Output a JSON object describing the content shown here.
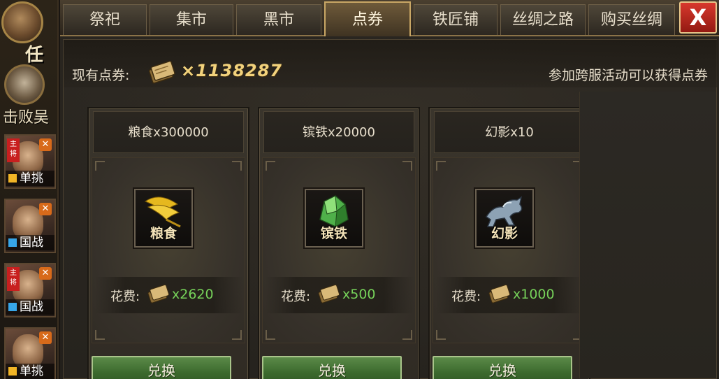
{
  "tabs": [
    {
      "label": "祭祀",
      "active": false
    },
    {
      "label": "集市",
      "active": false
    },
    {
      "label": "黑市",
      "active": false
    },
    {
      "label": "点券",
      "active": true
    },
    {
      "label": "铁匠铺",
      "active": false
    },
    {
      "label": "丝绸之路",
      "active": false
    },
    {
      "label": "购买丝绸",
      "active": false
    }
  ],
  "close_label": "X",
  "header": {
    "balance_label": "现有点券:",
    "balance_value": "×1138287",
    "hint": "参加跨服活动可以获得点券"
  },
  "items": [
    {
      "title": "粮食x300000",
      "icon_label": "粮食",
      "icon": "grain-icon",
      "cost_label": "花费:",
      "cost": "x2620",
      "button": "兑换"
    },
    {
      "title": "镔铁x20000",
      "icon_label": "镔铁",
      "icon": "iron-ore-icon",
      "cost_label": "花费:",
      "cost": "x500",
      "button": "兑换"
    },
    {
      "title": "幻影x10",
      "icon_label": "幻影",
      "icon": "phantom-horse-icon",
      "cost_label": "花费:",
      "cost": "x1000",
      "button": "兑换"
    }
  ],
  "left_strip": {
    "top_char": "任",
    "text": "击败吴",
    "heroes": [
      {
        "tag": "单挑",
        "color": "#f2b526",
        "lord": true
      },
      {
        "tag": "国战",
        "color": "#37a6e8",
        "lord": false
      },
      {
        "tag": "国战",
        "color": "#37a6e8",
        "lord": true
      },
      {
        "tag": "单挑",
        "color": "#f2b526",
        "lord": false
      }
    ],
    "lord_label": "主将"
  },
  "colors": {
    "accent_gold": "#c9a765",
    "cost_green": "#76d25a",
    "button_green": "#3c6a2e",
    "close_red": "#d8382d"
  }
}
